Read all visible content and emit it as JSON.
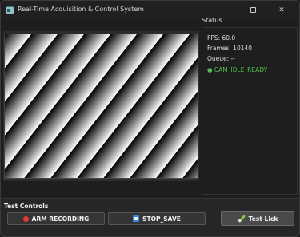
{
  "window": {
    "title": "Real-Time Acquisition & Control System",
    "controls": {
      "minimize": "",
      "maximize": "",
      "close": "✕"
    }
  },
  "camera": {
    "pattern": "diagonal-grating",
    "colors": {
      "dark": "#000000",
      "light": "#ffffff",
      "border": "#444444"
    }
  },
  "status": {
    "title": "Status",
    "fps": "FPS: 60.0",
    "frames": "Frames: 10140",
    "queue": "Queue: --",
    "camera_state": "● CAM_IDLE_READY",
    "state_color": "#4ec04e"
  },
  "controls": {
    "title": "Test Controls",
    "arm_label": "ARM RECORDING",
    "stop_label": "STOP_SAVE",
    "lick_label": "Test Lick",
    "icons": {
      "arm": "record-dot-icon",
      "stop": "stop-square-icon",
      "lick": "pencil-icon"
    }
  }
}
